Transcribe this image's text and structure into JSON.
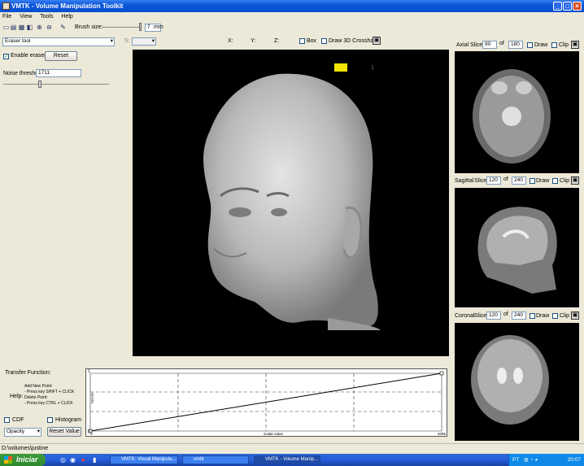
{
  "window": {
    "title": "VMTK - Volume Manipulation Toolkit"
  },
  "menu": [
    "File",
    "View",
    "Tools",
    "Help"
  ],
  "toolbar": {
    "brush_label": "Brush size:",
    "brush_value": "7",
    "brush_unit": "mm"
  },
  "left_panel": {
    "tool_select": "Eraser tool",
    "enable_eraser": "Enable eraser",
    "reset_label": "Reset",
    "noise_label": "Noise threshold",
    "noise_value": "1711"
  },
  "coords": {
    "x_label": "X:",
    "y_label": "Y:",
    "z_label": "Z:",
    "dropdown": "",
    "box_label": "Box",
    "crosshair_label": "Draw 3D Crosshair"
  },
  "slices": [
    {
      "name": "Axial",
      "slice_label": "Slice",
      "value": "90",
      "of": "of",
      "total": "180",
      "draw": "Draw",
      "clip": "Clip"
    },
    {
      "name": "Sagittal",
      "slice_label": "Slice",
      "value": "120",
      "of": "of",
      "total": "240",
      "draw": "Draw",
      "clip": "Clip"
    },
    {
      "name": "Coronal",
      "slice_label": "Slice",
      "value": "120",
      "of": "of",
      "total": "240",
      "draw": "Draw",
      "clip": "Clip"
    }
  ],
  "transfer": {
    "title": "Transfer Function:",
    "help_label": "Help:",
    "help_lines": [
      "Add New Point:",
      "- Press key SHIFT + CLICK",
      "Delete Point:",
      "- Press key CTRL + CLICK"
    ],
    "cdf_label": "CDF",
    "histogram_label": "Histogram",
    "mode_select": "Opacity",
    "reset_label": "Reset Value",
    "y_axis": "Opacity",
    "x_axis": "scalar value",
    "y_top": "1",
    "y_bottom": "0",
    "x_left": "0",
    "x_right": "4095"
  },
  "status": {
    "path": "D:\\volumes\\justine"
  },
  "taskbar": {
    "start": "Iniciar",
    "items": [
      "VMTK: Visual Manipula...",
      "vmtk",
      "VMTK - Volume Manip..."
    ],
    "lang": "PT",
    "clock": "20:07"
  }
}
